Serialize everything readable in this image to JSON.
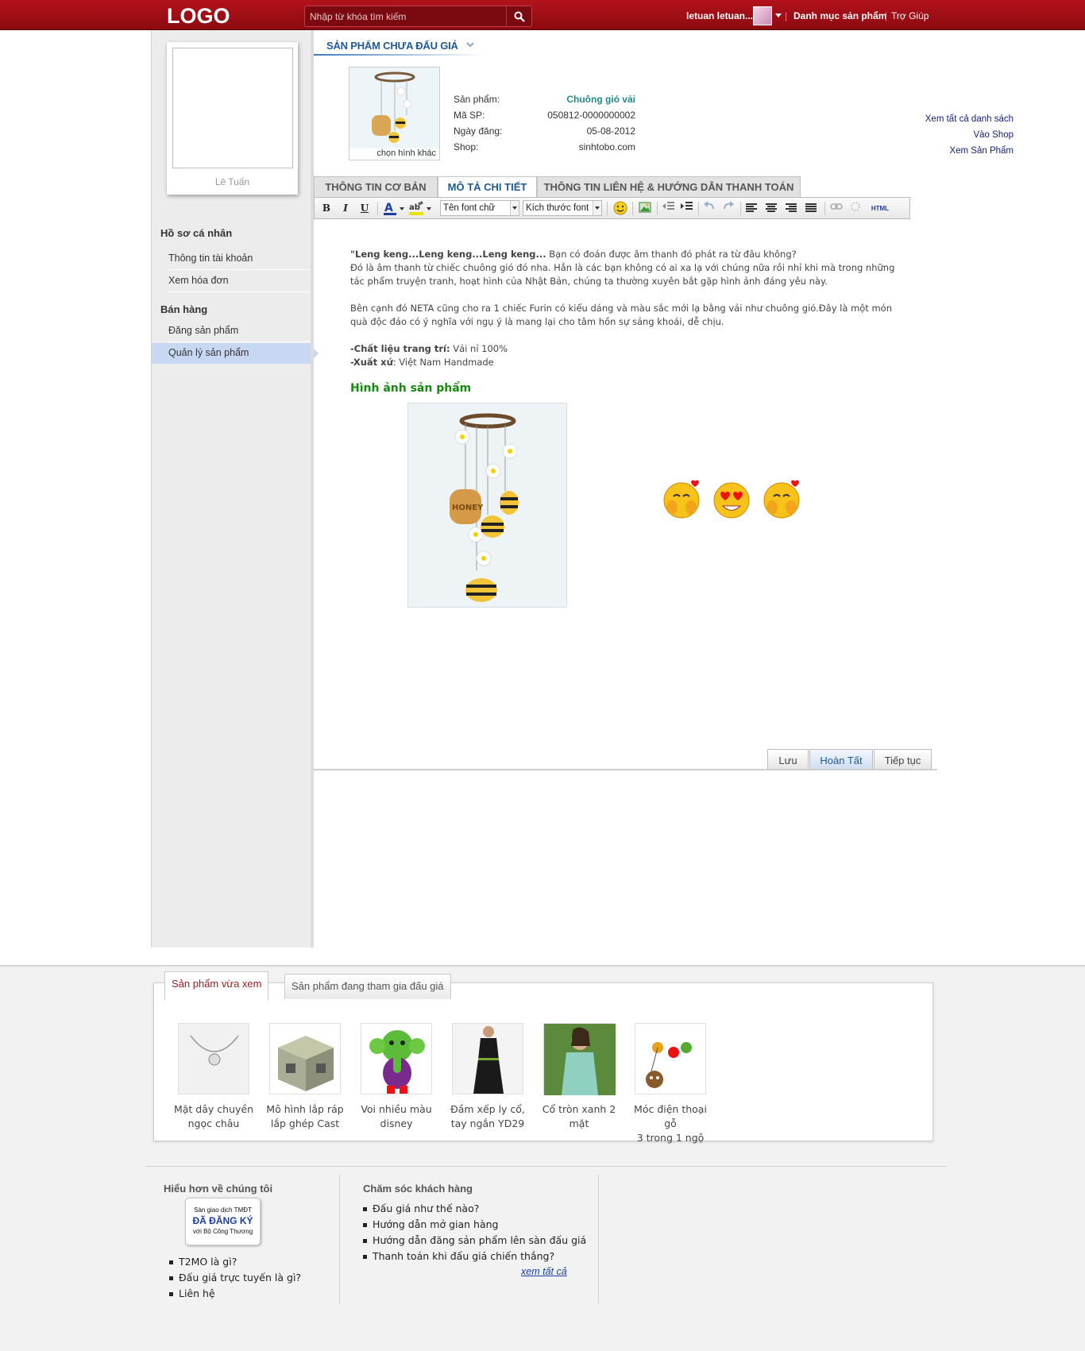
{
  "header": {
    "logo": "LOGO",
    "search_placeholder": "Nhập từ khóa tìm kiếm",
    "username": "letuan letuan...",
    "nav_categories": "Danh mục sản phẩm",
    "nav_help": "Trợ Giúp"
  },
  "sidebar": {
    "profile_name": "Lê Tuấn",
    "section_profile": "Hồ sơ cá nhân",
    "profile_items": [
      "Thông tin tài khoản",
      "Xem hóa đơn"
    ],
    "section_sales": "Bán hàng",
    "sales_items": [
      "Đăng sản phẩm",
      "Quản lý sản phẩm"
    ],
    "active_item": "Quản lý sản phẩm"
  },
  "main": {
    "page_title": "SẢN PHẨM CHƯA ĐẤU GIÁ",
    "thumb_label": "chọn hình khác",
    "info": {
      "product_label": "Sản phẩm:",
      "product_value": "Chuông gió vải",
      "code_label": "Mã SP:",
      "code_value": "050812-0000000002",
      "date_label": "Ngày đăng:",
      "date_value": "05-08-2012",
      "shop_label": "Shop:",
      "shop_value": "sinhtobo.com"
    },
    "right_links": [
      "Xem tất cả danh sách",
      "Vào Shop",
      "Xem Sản Phẩm"
    ],
    "tabs": [
      "THÔNG TIN CƠ BẢN",
      "MÔ TẢ CHI TIẾT",
      "THÔNG TIN LIÊN HỆ & HƯỚNG DẪN THANH TOÁN"
    ],
    "active_tab": "MÔ TẢ CHI TIẾT",
    "toolbar": {
      "bold": "B",
      "italic": "I",
      "underline": "U",
      "font_select": "Tên font chữ",
      "size_select": "Kích thước font",
      "html": "HTML"
    },
    "editor": {
      "p1_bold": "\"Leng keng...Leng keng...Leng keng...",
      "p1_rest": " Bạn có đoán được âm thanh đó phát ra từ đâu không?",
      "p2": "Đó là âm thanh từ chiếc chuông gió  đó nha. Hẳn là các bạn không  có ai xa lạ với chúng nữa rồi nhỉ khi mà trong những tác phẩm truyện tranh, hoạt hình của Nhật Bản, chúng ta thường xuyên bắt gặp hình ảnh đáng yêu này.",
      "p3": "Bên cạnh đó NETA cũng cho ra  1 chiếc Furin có  kiểu dáng và màu  sắc mới lạ bằng vải như chuông gió.Đây là một món quà  độc đáo có ý nghĩa với ngụ ý là mang lại cho tâm hồn sự sảng khoái, dễ chịu.",
      "material_label": "-Chất liệu trang trí:",
      "material_value": " Vải nỉ 100%",
      "origin_label": "-Xuất xứ",
      "origin_value": ": Việt Nam Handmade",
      "images_title": "Hình ảnh sản phẩm"
    },
    "buttons": {
      "save": "Lưu",
      "finish": "Hoàn Tất",
      "continue": "Tiếp tục"
    }
  },
  "recent": {
    "tab_viewed": "Sản phẩm vừa xem",
    "tab_bidding": "Sản phẩm đang tham gia đấu giá",
    "items": [
      {
        "line1": "Mặt dây chuyền",
        "line2": "ngọc châu"
      },
      {
        "line1": "Mô hình lắp ráp",
        "line2": "lắp ghép Cast"
      },
      {
        "line1": "Voi nhiều màu",
        "line2": "disney"
      },
      {
        "line1": "Đầm xếp ly cổ,",
        "line2": "tay ngắn YD29"
      },
      {
        "line1": "Cổ tròn xanh 2",
        "line2": "mặt"
      },
      {
        "line1": "Móc điện thoại gỗ",
        "line2": "3 trong 1 ngộ"
      }
    ]
  },
  "footer": {
    "about_title": "Hiểu hơn về chúng tôi",
    "badge_line1": "Sàn giao dịch TMĐT",
    "badge_line2": "ĐÃ ĐĂNG KÝ",
    "badge_line3": "với Bộ Công Thương",
    "about_links": [
      "T2MO là gì?",
      "Đấu giá trực tuyến là gì?",
      "Liên hệ"
    ],
    "care_title": "Chăm sóc khách hàng",
    "care_links": [
      "Đấu giá như thế nào?",
      "Hướng dẫn mở gian hàng",
      "Hướng dẫn đăng sản phẩm lên sàn đấu giá",
      "Thanh toán khi đấu giá chiến thắng?"
    ],
    "see_all": "xem tất cả"
  },
  "colors": {
    "header_red": "#a30f17",
    "accent_blue": "#1f5a96",
    "green_title": "#188a10"
  }
}
